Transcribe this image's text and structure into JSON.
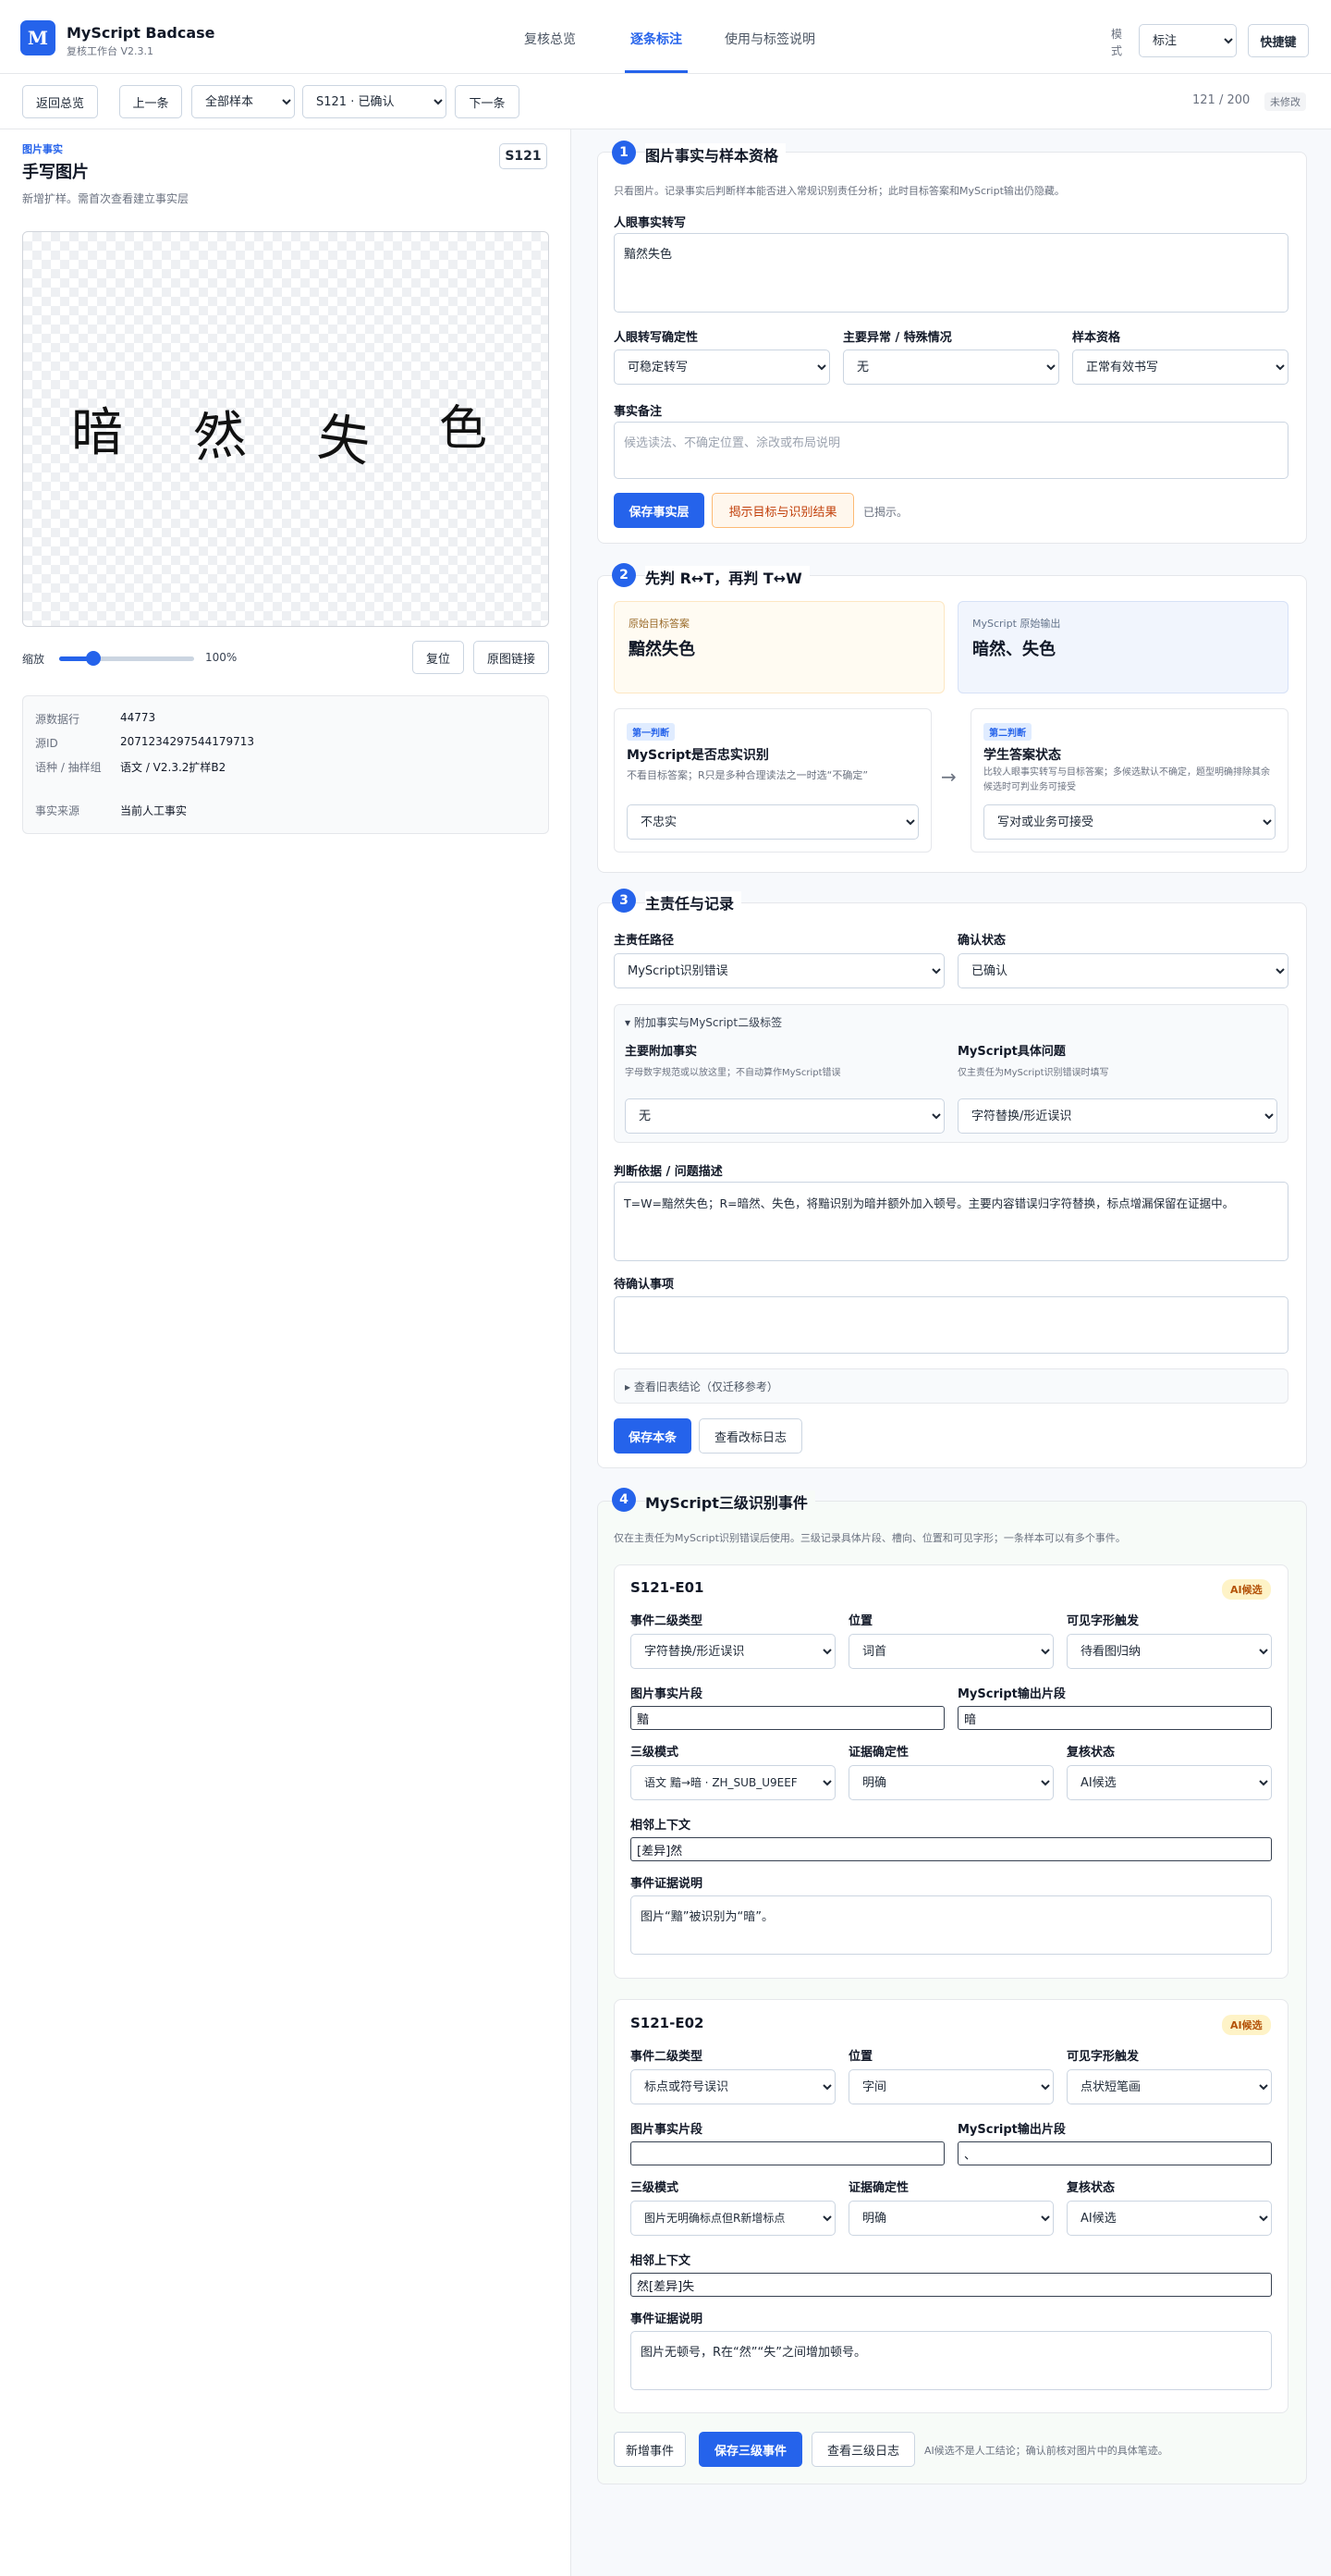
{
  "app": {
    "logo_letter": "M",
    "title": "MyScript Badcase",
    "subtitle": "复核工作台 V2.3.1"
  },
  "nav": {
    "tabs": [
      "复核总览",
      "逐条标注",
      "使用与标签说明"
    ],
    "active_index": 1
  },
  "mode": {
    "label": "模式",
    "value": "标注",
    "shortcut_label": "快捷键"
  },
  "toolbar": {
    "back_label": "返回总览",
    "prev_label": "上一条",
    "filter_value": "全部样本",
    "sample_value": "S121 · 已确认",
    "next_label": "下一条",
    "counter": "121 / 200",
    "status": "未修改"
  },
  "image_panel": {
    "tag": "图片事实",
    "title": "手写图片",
    "desc": "新增扩样。需首次查看建立事实层",
    "id_badge": "S121",
    "handwriting_glyphs": [
      "暗",
      "然",
      "失",
      "色"
    ],
    "zoom_label": "缩放",
    "zoom_value": 25,
    "zoom_text": "100%",
    "reset_label": "复位",
    "original_label": "原图链接",
    "meta": [
      {
        "key": "源数据行",
        "value": "44773"
      },
      {
        "key": "源ID",
        "value": "2071234297544179713"
      },
      {
        "key": "语种 / 抽样组",
        "value": "语文 / V2.3.2扩样B2"
      },
      {
        "key": "事实来源",
        "value": "当前人工事实"
      }
    ]
  },
  "section1": {
    "num": "1",
    "title": "图片事实与样本资格",
    "desc": "只看图片。记录事实后判断样本能否进入常规识别责任分析；此时目标答案和MyScript输出仍隐藏。",
    "transcript_label": "人眼事实转写",
    "transcript_value": "黯然失色",
    "certainty_label": "人眼转写确定性",
    "certainty_value": "可稳定转写",
    "anomaly_label": "主要异常 / 特殊情况",
    "anomaly_value": "无",
    "eligibility_label": "样本资格",
    "eligibility_value": "正常有效书写",
    "note_label": "事实备注",
    "note_placeholder": "候选读法、不确定位置、涂改或布局说明",
    "save_label": "保存事实层",
    "reveal_label": "揭示目标与识别结果",
    "revealed_text": "已揭示。"
  },
  "section2": {
    "num": "2",
    "title": "先判 R↔T，再判 T↔W",
    "target_caption": "原始目标答案",
    "target_value": "黯然失色",
    "output_caption": "MyScript 原始输出",
    "output_value": "暗然、失色",
    "first_tag": "第一判断",
    "first_title": "MyScript是否忠实识别",
    "first_hint": "不看目标答案；R只是多种合理读法之一时选“不确定”",
    "first_value": "不忠实",
    "arrow": "→",
    "second_tag": "第二判断",
    "second_title": "学生答案状态",
    "second_hint": "比较人眼事实转写与目标答案；多候选默认不确定，题型明确排除其余候选时可判业务可接受",
    "second_value": "写对或业务可接受"
  },
  "section3": {
    "num": "3",
    "title": "主责任与记录",
    "path_label": "主责任路径",
    "path_value": "MyScript识别错误",
    "confirm_label": "确认状态",
    "confirm_value": "已确认",
    "extra_title": "▾ 附加事实与MyScript二级标签",
    "extra_fact_label": "主要附加事实",
    "extra_fact_hint": "字母数字规范或以放这里；不自动算作MyScript错误",
    "extra_fact_value": "无",
    "problem_label": "MyScript具体问题",
    "problem_hint": "仅主责任为MyScript识别错误时填写",
    "problem_value": "字符替换/形近误识",
    "basis_label": "判断依据 / 问题描述",
    "basis_value": "T=W=黯然失色；R=暗然、失色，将黯识别为暗并额外加入顿号。主要内容错误归字符替换，标点增漏保留在证据中。",
    "pending_label": "待确认事项",
    "pending_value": "",
    "history_label": "▸ 查看旧表结论（仅迁移参考）",
    "save_label": "保存本条",
    "log_label": "查看改标日志"
  },
  "section4": {
    "num": "4",
    "title": "MyScript三级识别事件",
    "desc": "仅在主责任为MyScript识别错误后使用。三级记录具体片段、槽向、位置和可见字形；一条样本可以有多个事件。",
    "labels": {
      "type": "事件二级类型",
      "position": "位置",
      "glyph": "可见字形触发",
      "fact_seg": "图片事实片段",
      "output_seg": "MyScript输出片段",
      "mode": "三级模式",
      "certainty": "证据确定性",
      "review": "复核状态",
      "context": "相邻上下文",
      "evidence": "事件证据说明"
    },
    "events": [
      {
        "id": "S121-E01",
        "badge": "AI候选",
        "type": "字符替换/形近误识",
        "position": "词首",
        "glyph": "待看图归纳",
        "fact_seg": "黯",
        "output_seg": "暗",
        "mode": "语文 黯→暗 · ZH_SUB_U9EEF",
        "certainty": "明确",
        "review": "AI候选",
        "context": "[差异]然",
        "evidence": "图片“黯”被识别为“暗”。"
      },
      {
        "id": "S121-E02",
        "badge": "AI候选",
        "type": "标点或符号误识",
        "position": "字间",
        "glyph": "点状短笔画",
        "fact_seg": "",
        "output_seg": "、",
        "mode": "图片无明确标点但R新增标点",
        "certainty": "明确",
        "review": "AI候选",
        "context": "然[差异]失",
        "evidence": "图片无顿号，R在“然”“失”之间增加顿号。"
      }
    ],
    "add_label": "新增事件",
    "save_label": "保存三级事件",
    "log_label": "查看三级日志",
    "footer_hint": "AI候选不是人工结论；确认前核对图片中的具体笔迹。"
  }
}
